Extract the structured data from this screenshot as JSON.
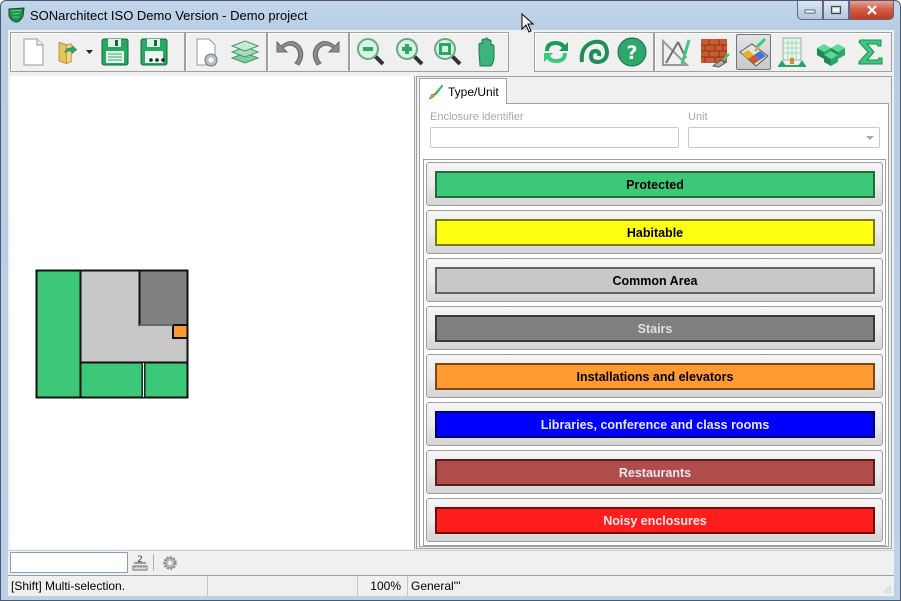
{
  "window": {
    "title": "SONarchitect ISO Demo Version - Demo project",
    "controls": [
      "minimize",
      "maximize",
      "close"
    ]
  },
  "toolbar": {
    "groups": [
      [
        {
          "name": "new-document",
          "icon": "blank-page-icon",
          "tooltip": "New"
        },
        {
          "name": "open",
          "icon": "open-folder-icon",
          "tooltip": "Open",
          "has_dropdown": true
        },
        {
          "name": "save",
          "icon": "floppy-disk-icon",
          "tooltip": "Save"
        },
        {
          "name": "save-as",
          "icon": "floppy-disk-dots-icon",
          "tooltip": "Save as"
        }
      ],
      [
        {
          "name": "document-settings",
          "icon": "page-gear-icon",
          "tooltip": "Settings"
        },
        {
          "name": "layers",
          "icon": "layers-icon",
          "tooltip": "Layers"
        }
      ],
      [
        {
          "name": "undo",
          "icon": "undo-arrow-icon",
          "tooltip": "Undo"
        },
        {
          "name": "redo",
          "icon": "redo-arrow-icon",
          "tooltip": "Redo"
        }
      ],
      [
        {
          "name": "zoom-out",
          "icon": "zoom-out-icon",
          "tooltip": "Zoom out"
        },
        {
          "name": "zoom-in",
          "icon": "zoom-in-icon",
          "tooltip": "Zoom in"
        },
        {
          "name": "zoom-fit",
          "icon": "zoom-fit-icon",
          "tooltip": "Zoom extents"
        },
        {
          "name": "pan",
          "icon": "hand-icon",
          "tooltip": "Pan"
        }
      ],
      [
        {
          "name": "refresh",
          "icon": "refresh-icon",
          "tooltip": "Refresh"
        },
        {
          "name": "spiral",
          "icon": "spiral-icon",
          "tooltip": "Acoustics"
        },
        {
          "name": "help",
          "icon": "help-icon",
          "tooltip": "Help"
        }
      ],
      [
        {
          "name": "drawing-tools",
          "icon": "compass-ruler-icon",
          "tooltip": "Geometry"
        },
        {
          "name": "constructions",
          "icon": "brick-wall-trowel-icon",
          "tooltip": "Constructions"
        },
        {
          "name": "enclosure-types",
          "icon": "floorplan-brush-icon",
          "tooltip": "Enclosure types",
          "active": true
        },
        {
          "name": "building",
          "icon": "building-icon",
          "tooltip": "Building"
        },
        {
          "name": "3d-blocks",
          "icon": "cubes-icon",
          "tooltip": "3D"
        },
        {
          "name": "results",
          "icon": "sigma-icon",
          "tooltip": "Results"
        }
      ]
    ]
  },
  "panel": {
    "tab_label": "Type/Unit",
    "enclosure_label": "Enclosure identifier",
    "enclosure_value": "",
    "unit_label": "Unit",
    "unit_value": "",
    "types": [
      {
        "label": "Protected",
        "color": "#3cc878",
        "border": "#1e6e3c",
        "text_color": "#000000"
      },
      {
        "label": "Habitable",
        "color": "#ffff14",
        "border": "#7a7a10",
        "text_color": "#000000"
      },
      {
        "label": "Common Area",
        "color": "#c8c8c8",
        "border": "#646464",
        "text_color": "#000000"
      },
      {
        "label": "Stairs",
        "color": "#808080",
        "border": "#3a3a3a",
        "text_color": "#e0e0e0"
      },
      {
        "label": "Installations and elevators",
        "color": "#ff9a32",
        "border": "#7a4a14",
        "text_color": "#000000"
      },
      {
        "label": "Libraries, conference and class rooms",
        "color": "#0000ff",
        "border": "#00006e",
        "text_color": "#e8e8f4"
      },
      {
        "label": "Restaurants",
        "color": "#b04c4c",
        "border": "#5a1e1e",
        "text_color": "#f0e8e8"
      },
      {
        "label": "Noisy enclosures",
        "color": "#ff1e1e",
        "border": "#780a0a",
        "text_color": "#f4e6e6"
      }
    ]
  },
  "floorplan": {
    "rooms": [
      {
        "name": "left-room",
        "type": "Protected"
      },
      {
        "name": "center-room",
        "type": "Common Area"
      },
      {
        "name": "top-right-room",
        "type": "Stairs"
      },
      {
        "name": "small-room",
        "type": "Installations and elevators"
      },
      {
        "name": "bottom-middle-room",
        "type": "Protected"
      },
      {
        "name": "bottom-right-room",
        "type": "Protected"
      }
    ]
  },
  "bottombar": {
    "input_value": "",
    "ruler_label": "2"
  },
  "statusbar": {
    "hint": "[Shift] Multi-selection.",
    "cell2": "",
    "zoom": "100%",
    "layer": "General'''"
  }
}
